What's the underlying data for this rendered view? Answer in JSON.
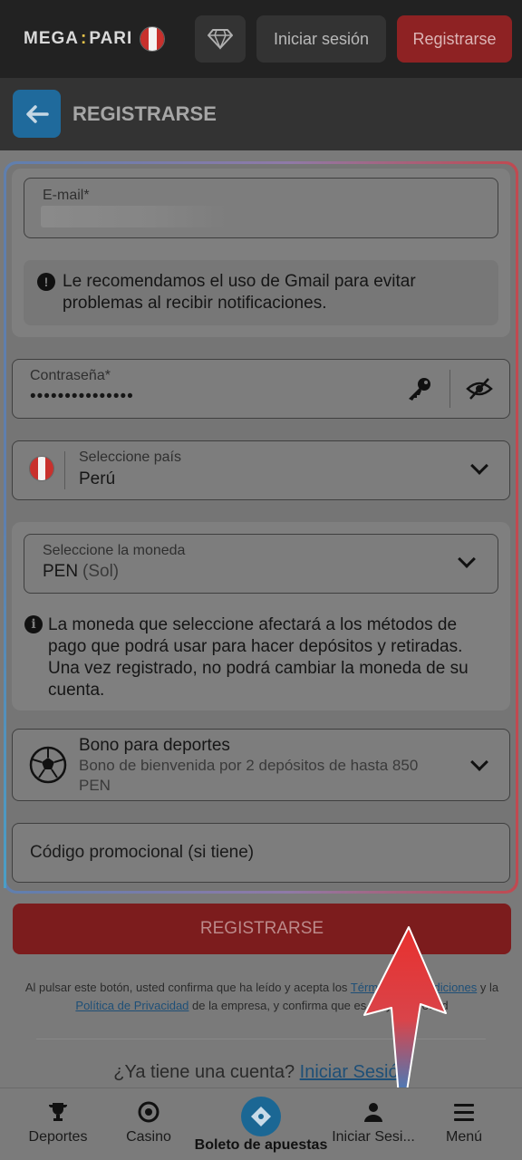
{
  "topbar": {
    "logo_left": "MEGA",
    "logo_colon": ":",
    "logo_right": "PARI",
    "login_label": "Iniciar sesión",
    "register_label": "Registrarse"
  },
  "header": {
    "title": "REGISTRARSE"
  },
  "form": {
    "email": {
      "label": "E-mail*",
      "value": ""
    },
    "gmail_notice": "Le recomendamos el uso de Gmail para evitar problemas al recibir notificaciones.",
    "password": {
      "label": "Contraseña*",
      "value": "•••••••••••••••"
    },
    "country": {
      "label": "Seleccione país",
      "value": "Perú"
    },
    "currency": {
      "label": "Seleccione la moneda",
      "code": "PEN",
      "name": "(Sol)"
    },
    "currency_notice": "La moneda que seleccione afectará a los métodos de pago que podrá usar para hacer depósitos y retiradas. Una vez registrado, no podrá cambiar la moneda de su cuenta.",
    "bonus": {
      "title": "Bono para deportes",
      "desc_line1": "Bono de bienvenida por 2 depósitos de hasta 850",
      "desc_line2": "PEN"
    },
    "promo": {
      "placeholder": "Código promocional (si tiene)"
    }
  },
  "register_button": "REGISTRARSE",
  "terms": {
    "part1": "Al pulsar este botón, usted confirma que ha leído y acepta los ",
    "link1": "Términos y Condiciones",
    "part2": " y la ",
    "link2": "Política de Privacidad",
    "part3": " de la empresa, y confirma que es mayor de edad"
  },
  "already": {
    "text": "¿Ya tiene una cuenta? ",
    "link": "Iniciar Sesión"
  },
  "bottom_nav": {
    "items": [
      {
        "label": "Deportes",
        "icon": "trophy-icon"
      },
      {
        "label": "Casino",
        "icon": "casino-chip-icon"
      },
      {
        "label": "Boleto de apuestas",
        "icon": "ticket-icon"
      },
      {
        "label": "Iniciar Sesi...",
        "icon": "user-icon"
      },
      {
        "label": "Menú",
        "icon": "hamburger-icon"
      }
    ]
  },
  "colors": {
    "brand_red": "#c0282b",
    "brand_blue": "#1f78b4",
    "overlay_gray": "#7a7a7a"
  }
}
